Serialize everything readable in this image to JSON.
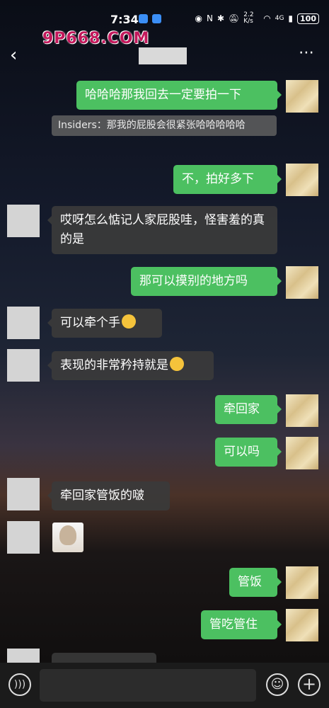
{
  "status_bar": {
    "time": "7:34",
    "network_speed": "2.2 K/s",
    "signal": "4G",
    "battery": "100"
  },
  "watermark": "9P668.COM",
  "header": {
    "back_icon": "chevron-left",
    "more_icon": "⋯"
  },
  "messages": [
    {
      "sender": "me",
      "text": "哈哈哈那我回去一定要拍一下"
    },
    {
      "sender": "quote",
      "text": "Insiders：那我的屁股会很紧张哈哈哈哈哈"
    },
    {
      "sender": "me",
      "text": "不，拍好多下"
    },
    {
      "sender": "other",
      "text": "哎呀怎么惦记人家屁股哇，怪害羞的真的是"
    },
    {
      "sender": "me",
      "text": "那可以摸别的地方吗"
    },
    {
      "sender": "other",
      "text": "可以牵个手"
    },
    {
      "sender": "other",
      "text": "表现的非常矜持就是"
    },
    {
      "sender": "me",
      "text": "牵回家"
    },
    {
      "sender": "me",
      "text": "可以吗"
    },
    {
      "sender": "other",
      "text": "牵回家管饭的啵"
    },
    {
      "sender": "other",
      "text": "",
      "sticker": "sticker-icon"
    },
    {
      "sender": "me",
      "text": "管饭"
    },
    {
      "sender": "me",
      "text": "管吃管住"
    }
  ],
  "input_bar": {
    "voice_icon": "voice-icon",
    "emoji_icon": "☺",
    "plus_icon": "+"
  }
}
